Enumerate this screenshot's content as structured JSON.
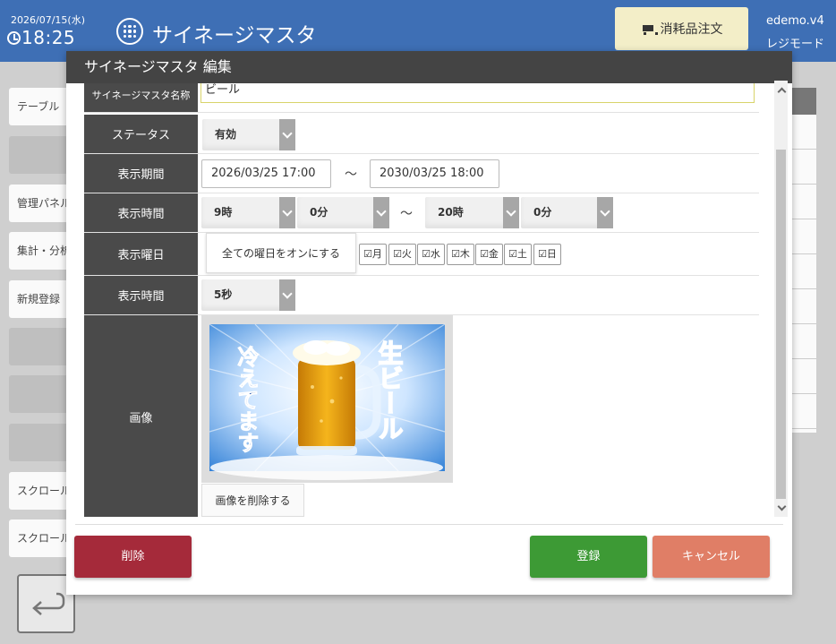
{
  "header": {
    "date": "2026/07/15(水)",
    "time": "18:25",
    "app_title": "サイネージマスタ",
    "order_button": "消耗品注文",
    "version": "edemo.v4",
    "mode": "レジモード"
  },
  "background_menu": [
    {
      "label": "テーブル",
      "grey": false
    },
    {
      "label": "",
      "grey": true
    },
    {
      "label": "管理パネル",
      "grey": false
    },
    {
      "label": "集計・分析",
      "grey": false
    },
    {
      "label": "新規登録",
      "grey": false
    },
    {
      "label": "",
      "grey": true
    },
    {
      "label": "",
      "grey": true
    },
    {
      "label": "",
      "grey": true
    },
    {
      "label": "スクロール",
      "grey": false
    },
    {
      "label": "スクロール",
      "grey": false
    }
  ],
  "modal": {
    "title": "サイネージマスタ 編集",
    "fields": {
      "name_label": "サイネージマスタ名称",
      "name_value": "ビール",
      "status_label": "ステータス",
      "status_value": "有効",
      "period_label": "表示期間",
      "period_start": "2026/03/25 17:00",
      "period_end": "2030/03/25 18:00",
      "range_sep": "～",
      "time_label": "表示時間",
      "time_start_hour": "9時",
      "time_start_min": "0分",
      "time_end_hour": "20時",
      "time_end_min": "0分",
      "days_label": "表示曜日",
      "all_days_button": "全ての曜日をオンにする",
      "days": [
        "☑月",
        "☑火",
        "☑水",
        "☑木",
        "☑金",
        "☑土",
        "☑日"
      ],
      "duration_label": "表示時間",
      "duration_value": "5秒",
      "image_label": "画像",
      "image_text_left": "冷えてます",
      "image_text_right": "生ビール",
      "delete_image_button": "画像を削除する"
    },
    "buttons": {
      "delete": "削除",
      "register": "登録",
      "cancel": "キャンセル"
    }
  },
  "colors": {
    "header_bg": "#3e6fb5",
    "label_bg": "#4a4a4a",
    "delete": "#a52a3a",
    "register": "#3d9a35",
    "cancel": "#e07e66"
  }
}
